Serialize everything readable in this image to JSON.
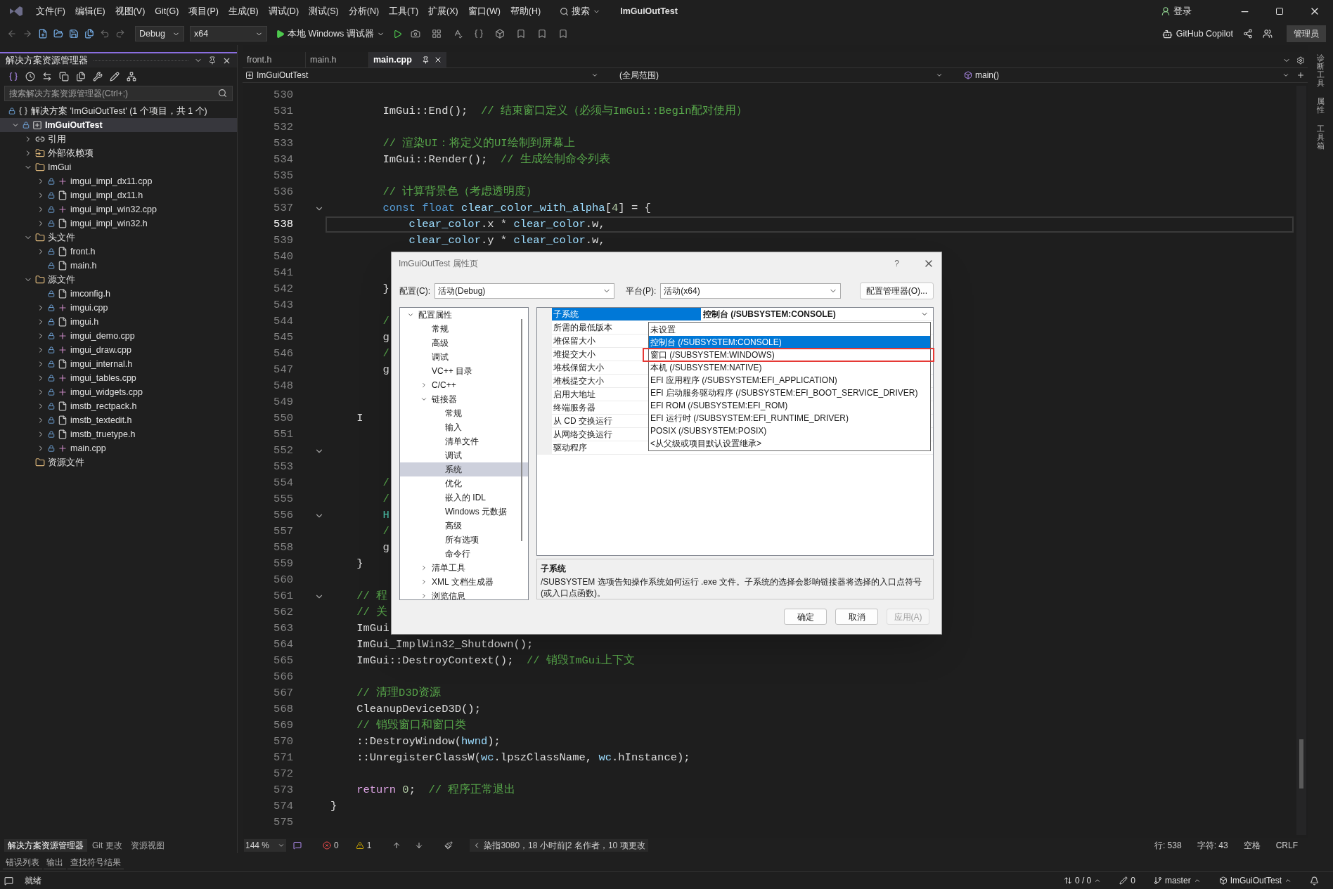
{
  "title_bar": {
    "menu": [
      "文件(F)",
      "编辑(E)",
      "视图(V)",
      "Git(G)",
      "项目(P)",
      "生成(B)",
      "调试(D)",
      "测试(S)",
      "分析(N)",
      "工具(T)",
      "扩展(X)",
      "窗口(W)",
      "帮助(H)"
    ],
    "search": "搜索",
    "title": "ImGuiOutTest",
    "sign_in": "登录"
  },
  "toolbar": {
    "configuration": "Debug",
    "platform": "x64",
    "run": "本地 Windows 调试器",
    "copilot": "GitHub Copilot",
    "admin": "管理员"
  },
  "solution_explorer": {
    "title": "解决方案资源管理器",
    "search": {
      "placeholder": "搜索解决方案资源管理器(Ctrl+;)"
    },
    "solution": "解决方案 'ImGuiOutTest' (1 个项目，共 1 个)",
    "tree": [
      {
        "label": "ImGuiOutTest",
        "kind": "project",
        "expanded": true,
        "selected": true,
        "children": [
          {
            "label": "引用",
            "kind": "references",
            "expanded": false,
            "selected": false
          },
          {
            "label": "外部依赖项",
            "kind": "external",
            "expanded": false,
            "selected": false
          },
          {
            "label": "ImGui",
            "kind": "filter",
            "expanded": true,
            "selected": false,
            "children": [
              {
                "label": "imgui_impl_dx11.cpp",
                "kind": "cpp",
                "expanded": false,
                "selected": false
              },
              {
                "label": "imgui_impl_dx11.h",
                "kind": "h",
                "expanded": false,
                "selected": false
              },
              {
                "label": "imgui_impl_win32.cpp",
                "kind": "cpp",
                "expanded": false,
                "selected": false
              },
              {
                "label": "imgui_impl_win32.h",
                "kind": "h",
                "expanded": false,
                "selected": false
              }
            ]
          },
          {
            "label": "头文件",
            "kind": "filter",
            "expanded": true,
            "selected": false,
            "children": [
              {
                "label": "front.h",
                "kind": "h",
                "expanded": false,
                "selected": false
              },
              {
                "label": "main.h",
                "kind": "h",
                "selected": false
              }
            ]
          },
          {
            "label": "源文件",
            "kind": "filter",
            "expanded": true,
            "selected": false,
            "children": [
              {
                "label": "imconfig.h",
                "kind": "h",
                "selected": false
              },
              {
                "label": "imgui.cpp",
                "kind": "cpp",
                "expanded": false,
                "selected": false
              },
              {
                "label": "imgui.h",
                "kind": "h",
                "expanded": false,
                "selected": false
              },
              {
                "label": "imgui_demo.cpp",
                "kind": "cpp",
                "expanded": false,
                "selected": false
              },
              {
                "label": "imgui_draw.cpp",
                "kind": "cpp",
                "expanded": false,
                "selected": false
              },
              {
                "label": "imgui_internal.h",
                "kind": "h",
                "expanded": false,
                "selected": false
              },
              {
                "label": "imgui_tables.cpp",
                "kind": "cpp",
                "expanded": false,
                "selected": false
              },
              {
                "label": "imgui_widgets.cpp",
                "kind": "cpp",
                "expanded": false,
                "selected": false
              },
              {
                "label": "imstb_rectpack.h",
                "kind": "h",
                "expanded": false,
                "selected": false
              },
              {
                "label": "imstb_textedit.h",
                "kind": "h",
                "expanded": false,
                "selected": false
              },
              {
                "label": "imstb_truetype.h",
                "kind": "h",
                "expanded": false,
                "selected": false
              },
              {
                "label": "main.cpp",
                "kind": "cpp",
                "expanded": false,
                "selected": false
              }
            ]
          },
          {
            "label": "资源文件",
            "kind": "filter",
            "selected": false
          }
        ]
      }
    ],
    "tabs": [
      {
        "label": "解决方案资源管理器",
        "selected": true
      },
      {
        "label": "Git 更改",
        "selected": false
      },
      {
        "label": "资源视图",
        "selected": false
      }
    ]
  },
  "editor": {
    "tabs": [
      {
        "label": "front.h",
        "selected": false
      },
      {
        "label": "main.h",
        "selected": false
      },
      {
        "label": "main.cpp",
        "selected": true
      }
    ],
    "nav": {
      "project": "ImGuiOutTest",
      "scope": "(全局范围)",
      "member": "main()"
    },
    "lines": [
      {
        "number": "530",
        "foldable": false,
        "current": false
      },
      {
        "number": "531",
        "foldable": false,
        "current": false,
        "segments": [
          {
            "kind": "t",
            "text": "        ImGui::End();  "
          },
          {
            "kind": "cm",
            "text": "// 结束窗口定义（必须与ImGui::Begin配对使用）"
          }
        ]
      },
      {
        "number": "532",
        "foldable": false,
        "current": false
      },
      {
        "number": "533",
        "foldable": false,
        "current": false,
        "segments": [
          {
            "kind": "cm",
            "text": "        // 渲染UI：将定义的UI绘制到屏幕上"
          }
        ]
      },
      {
        "number": "534",
        "foldable": false,
        "current": false,
        "segments": [
          {
            "kind": "t",
            "text": "        ImGui::Render();  "
          },
          {
            "kind": "cm",
            "text": "// 生成绘制命令列表"
          }
        ]
      },
      {
        "number": "535",
        "foldable": false,
        "current": false
      },
      {
        "number": "536",
        "foldable": false,
        "current": false,
        "segments": [
          {
            "kind": "cm",
            "text": "        // 计算背景色（考虑透明度）"
          }
        ]
      },
      {
        "number": "537",
        "foldable": true,
        "current": false,
        "segments": [
          {
            "kind": "kw",
            "text": "        const float "
          },
          {
            "kind": "var",
            "text": "clear_color_with_alpha"
          },
          {
            "kind": "t",
            "text": "["
          },
          {
            "kind": "num",
            "text": "4"
          },
          {
            "kind": "t",
            "text": "] = {"
          }
        ]
      },
      {
        "number": "538",
        "foldable": false,
        "current": true,
        "segments": [
          {
            "kind": "var",
            "text": "            clear_color"
          },
          {
            "kind": "t",
            "text": ".x * "
          },
          {
            "kind": "var",
            "text": "clear_color"
          },
          {
            "kind": "t",
            "text": ".w,"
          }
        ]
      },
      {
        "number": "539",
        "foldable": false,
        "current": false,
        "segments": [
          {
            "kind": "var",
            "text": "            clear_color"
          },
          {
            "kind": "t",
            "text": ".y * "
          },
          {
            "kind": "var",
            "text": "clear_color"
          },
          {
            "kind": "t",
            "text": ".w,"
          }
        ]
      },
      {
        "number": "540",
        "foldable": false,
        "current": false
      },
      {
        "number": "541",
        "foldable": false,
        "current": false
      },
      {
        "number": "542",
        "foldable": false,
        "current": false,
        "segments": [
          {
            "kind": "t",
            "text": "        }"
          }
        ]
      },
      {
        "number": "543",
        "foldable": false,
        "current": false
      },
      {
        "number": "544",
        "foldable": false,
        "current": false,
        "segments": [
          {
            "kind": "cm",
            "text": "        /"
          }
        ]
      },
      {
        "number": "545",
        "foldable": false,
        "current": false,
        "segments": [
          {
            "kind": "t",
            "text": "        g"
          }
        ]
      },
      {
        "number": "546",
        "foldable": false,
        "current": false,
        "segments": [
          {
            "kind": "cm",
            "text": "        /"
          }
        ]
      },
      {
        "number": "547",
        "foldable": false,
        "current": false,
        "segments": [
          {
            "kind": "t",
            "text": "        g"
          }
        ]
      },
      {
        "number": "548",
        "foldable": false,
        "current": false
      },
      {
        "number": "549",
        "foldable": false,
        "current": false
      },
      {
        "number": "550",
        "foldable": false,
        "current": false,
        "segments": [
          {
            "kind": "t",
            "text": "    I"
          }
        ]
      },
      {
        "number": "551",
        "foldable": false,
        "current": false
      },
      {
        "number": "552",
        "foldable": true,
        "current": false
      },
      {
        "number": "553",
        "foldable": false,
        "current": false
      },
      {
        "number": "554",
        "foldable": false,
        "current": false,
        "segments": [
          {
            "kind": "cm",
            "text": "        /"
          }
        ]
      },
      {
        "number": "555",
        "foldable": false,
        "current": false,
        "segments": [
          {
            "kind": "cm",
            "text": "        /"
          }
        ]
      },
      {
        "number": "556",
        "foldable": true,
        "current": false,
        "segments": [
          {
            "kind": "type",
            "text": "        H"
          }
        ]
      },
      {
        "number": "557",
        "foldable": false,
        "current": false,
        "segments": [
          {
            "kind": "cm",
            "text": "        /"
          }
        ]
      },
      {
        "number": "558",
        "foldable": false,
        "current": false,
        "segments": [
          {
            "kind": "t",
            "text": "        g"
          }
        ]
      },
      {
        "number": "559",
        "foldable": false,
        "current": false,
        "segments": [
          {
            "kind": "t",
            "text": "    }"
          }
        ]
      },
      {
        "number": "560",
        "foldable": false,
        "current": false
      },
      {
        "number": "561",
        "foldable": true,
        "current": false,
        "segments": [
          {
            "kind": "cm",
            "text": "    // 程"
          }
        ]
      },
      {
        "number": "562",
        "foldable": false,
        "current": false,
        "segments": [
          {
            "kind": "cm",
            "text": "    // 关"
          }
        ]
      },
      {
        "number": "563",
        "foldable": false,
        "current": false,
        "segments": [
          {
            "kind": "t",
            "text": "    ImGui"
          }
        ]
      },
      {
        "number": "564",
        "foldable": false,
        "current": false,
        "segments": [
          {
            "kind": "t",
            "text": "    ImGui_ImplWin32_Shutdown();"
          }
        ]
      },
      {
        "number": "565",
        "foldable": false,
        "current": false,
        "segments": [
          {
            "kind": "t",
            "text": "    ImGui::DestroyContext();  "
          },
          {
            "kind": "cm",
            "text": "// 销毁ImGui上下文"
          }
        ]
      },
      {
        "number": "566",
        "foldable": false,
        "current": false
      },
      {
        "number": "567",
        "foldable": false,
        "current": false,
        "segments": [
          {
            "kind": "cm",
            "text": "    // 清理D3D资源"
          }
        ]
      },
      {
        "number": "568",
        "foldable": false,
        "current": false,
        "segments": [
          {
            "kind": "t",
            "text": "    CleanupDeviceD3D();"
          }
        ]
      },
      {
        "number": "569",
        "foldable": false,
        "current": false,
        "segments": [
          {
            "kind": "cm",
            "text": "    // 销毁窗口和窗口类"
          }
        ]
      },
      {
        "number": "570",
        "foldable": false,
        "current": false,
        "segments": [
          {
            "kind": "t",
            "text": "    ::DestroyWindow("
          },
          {
            "kind": "var",
            "text": "hwnd"
          },
          {
            "kind": "t",
            "text": ");"
          }
        ]
      },
      {
        "number": "571",
        "foldable": false,
        "current": false,
        "segments": [
          {
            "kind": "t",
            "text": "    ::UnregisterClassW("
          },
          {
            "kind": "var",
            "text": "wc"
          },
          {
            "kind": "t",
            "text": ".lpszClassName, "
          },
          {
            "kind": "var",
            "text": "wc"
          },
          {
            "kind": "t",
            "text": ".hInstance);"
          }
        ]
      },
      {
        "number": "572",
        "foldable": false,
        "current": false
      },
      {
        "number": "573",
        "foldable": false,
        "current": false,
        "segments": [
          {
            "kind": "ctl",
            "text": "    return "
          },
          {
            "kind": "num",
            "text": "0"
          },
          {
            "kind": "t",
            "text": ";  "
          },
          {
            "kind": "cm",
            "text": "// 程序正常退出"
          }
        ]
      },
      {
        "number": "574",
        "foldable": false,
        "current": false,
        "segments": [
          {
            "kind": "t",
            "text": "}"
          }
        ]
      },
      {
        "number": "575",
        "foldable": false,
        "current": false
      }
    ],
    "status": {
      "zoom": "144 %",
      "errors": "0",
      "warnings": "1",
      "blame": "染指3080，18 小时前|2 名作者，10 项更改",
      "line": "行: 538",
      "column": "字符: 43",
      "indent": "空格",
      "line_ending": "CRLF"
    }
  },
  "side_strip": [
    "诊断工具",
    "属性",
    "工具箱"
  ],
  "dialog": {
    "title": "ImGuiOutTest 属性页",
    "help": "?",
    "config_label": "配置(C):",
    "config": "活动(Debug)",
    "platform_label": "平台(P):",
    "platform": "活动(x64)",
    "manager": "配置管理器(O)...",
    "tree": [
      {
        "label": "配置属性",
        "expanded": true,
        "selected": false,
        "children": [
          {
            "label": "常规",
            "selected": false
          },
          {
            "label": "高级",
            "selected": false
          },
          {
            "label": "调试",
            "selected": false
          },
          {
            "label": "VC++ 目录",
            "selected": false
          },
          {
            "label": "C/C++",
            "expanded": false,
            "selected": false
          },
          {
            "label": "链接器",
            "expanded": true,
            "selected": false,
            "children": [
              {
                "label": "常规",
                "selected": false
              },
              {
                "label": "输入",
                "selected": false
              },
              {
                "label": "清单文件",
                "selected": false
              },
              {
                "label": "调试",
                "selected": false
              },
              {
                "label": "系统",
                "selected": true
              },
              {
                "label": "优化",
                "selected": false
              },
              {
                "label": "嵌入的 IDL",
                "selected": false
              },
              {
                "label": "Windows 元数据",
                "selected": false
              },
              {
                "label": "高级",
                "selected": false
              },
              {
                "label": "所有选项",
                "selected": false
              },
              {
                "label": "命令行",
                "selected": false
              }
            ]
          },
          {
            "label": "清单工具",
            "expanded": false,
            "selected": false
          },
          {
            "label": "XML 文档生成器",
            "expanded": false,
            "selected": false
          },
          {
            "label": "浏览信息",
            "expanded": false,
            "selected": false
          }
        ]
      }
    ],
    "properties": [
      {
        "name": "子系统",
        "value": "控制台 (/SUBSYSTEM:CONSOLE)",
        "selected": true
      },
      {
        "name": "所需的最低版本",
        "selected": false
      },
      {
        "name": "堆保留大小",
        "selected": false
      },
      {
        "name": "堆提交大小",
        "selected": false
      },
      {
        "name": "堆栈保留大小",
        "selected": false
      },
      {
        "name": "堆栈提交大小",
        "selected": false
      },
      {
        "name": "启用大地址",
        "selected": false
      },
      {
        "name": "终端服务器",
        "selected": false
      },
      {
        "name": "从 CD 交换运行",
        "selected": false
      },
      {
        "name": "从网络交换运行",
        "selected": false
      },
      {
        "name": "驱动程序",
        "selected": false
      }
    ],
    "options": [
      {
        "label": "未设置",
        "selected": false,
        "marked": false
      },
      {
        "label": "控制台 (/SUBSYSTEM:CONSOLE)",
        "selected": true,
        "marked": false
      },
      {
        "label": "窗口 (/SUBSYSTEM:WINDOWS)",
        "selected": false,
        "marked": true
      },
      {
        "label": "本机 (/SUBSYSTEM:NATIVE)",
        "selected": false,
        "marked": false
      },
      {
        "label": "EFI 应用程序 (/SUBSYSTEM:EFI_APPLICATION)",
        "selected": false,
        "marked": false
      },
      {
        "label": "EFI 启动服务驱动程序 (/SUBSYSTEM:EFI_BOOT_SERVICE_DRIVER)",
        "selected": false,
        "marked": false
      },
      {
        "label": "EFI ROM (/SUBSYSTEM:EFI_ROM)",
        "selected": false,
        "marked": false
      },
      {
        "label": "EFI 运行时 (/SUBSYSTEM:EFI_RUNTIME_DRIVER)",
        "selected": false,
        "marked": false
      },
      {
        "label": "POSIX (/SUBSYSTEM:POSIX)",
        "selected": false,
        "marked": false
      },
      {
        "label": "<从父级或项目默认设置继承>",
        "selected": false,
        "marked": false
      }
    ],
    "description": {
      "title": "子系统",
      "text": "/SUBSYSTEM 选项告知操作系统如何运行 .exe 文件。子系统的选择会影响链接器将选择的入口点符号(或入口点函数)。"
    },
    "buttons": [
      {
        "label": "确定",
        "disabled": false
      },
      {
        "label": "取消",
        "disabled": false
      },
      {
        "label": "应用(A)",
        "disabled": true
      }
    ]
  },
  "bottom_tabs": [
    {
      "label": "错误列表",
      "selected": false
    },
    {
      "label": "输出",
      "selected": false
    },
    {
      "label": "查找符号结果",
      "selected": false
    }
  ],
  "status_bar": {
    "message": "就绪",
    "changes": "0 / 0",
    "edits": "0",
    "branch": "master",
    "repo": "ImGuiOutTest"
  }
}
